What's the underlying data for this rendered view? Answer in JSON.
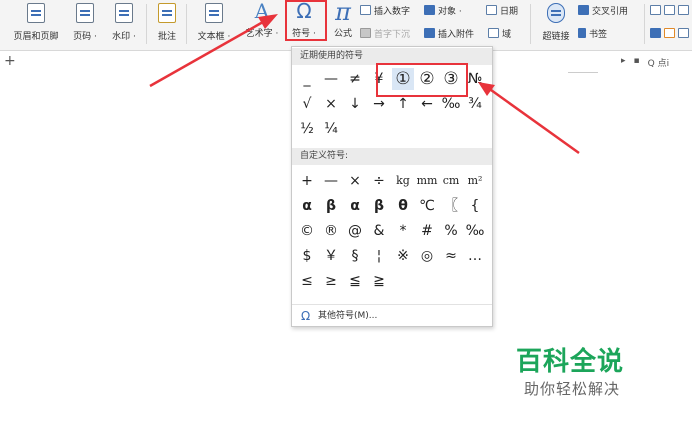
{
  "ribbon": {
    "header_footer": "页眉和页脚",
    "page_number": "页码 ·",
    "watermark": "水印 ·",
    "comment": "批注",
    "textbox": "文本框 ·",
    "art_text": "艺术字 ·",
    "symbol": "符号 ·",
    "formula": "公式",
    "insert_number": "插入数字",
    "object": "对象 ·",
    "date": "日期",
    "drop_cap": "首字下沉",
    "insert_attachment": "插入附件",
    "field": "域",
    "hyperlink": "超链接",
    "cross_ref": "交叉引用",
    "bookmark": "书签"
  },
  "document": {
    "plus_sign": "+",
    "right_tools": "Q 点i"
  },
  "symbol_menu": {
    "recent_header": "近期使用的符号",
    "recent": [
      "_",
      "—",
      "≠",
      "¥",
      "①",
      "②",
      "③",
      "№",
      "√",
      "×",
      "↓",
      "→",
      "↑",
      "←",
      "‰",
      "¾",
      "½",
      "¼"
    ],
    "custom_header": "自定义符号:",
    "custom": [
      "+",
      "—",
      "×",
      "÷",
      "kg",
      "mm",
      "cm",
      "m²",
      "α",
      "β",
      "α",
      "β",
      "θ",
      "℃",
      "〖",
      "{",
      "©",
      "®",
      "@",
      "&",
      "*",
      "#",
      "%",
      "‰",
      "$",
      "￥",
      "§",
      "¦",
      "※",
      "◎",
      "≈",
      "…",
      "≤",
      "≥",
      "≦",
      "≧"
    ],
    "more": "其他符号(M)..."
  },
  "watermark": {
    "title": "百科全说",
    "subtitle": "助你轻松解决"
  },
  "colors": {
    "highlight_red": "#e8333b",
    "brand_green": "#1ca55a",
    "icon_blue": "#3d6fb6"
  }
}
